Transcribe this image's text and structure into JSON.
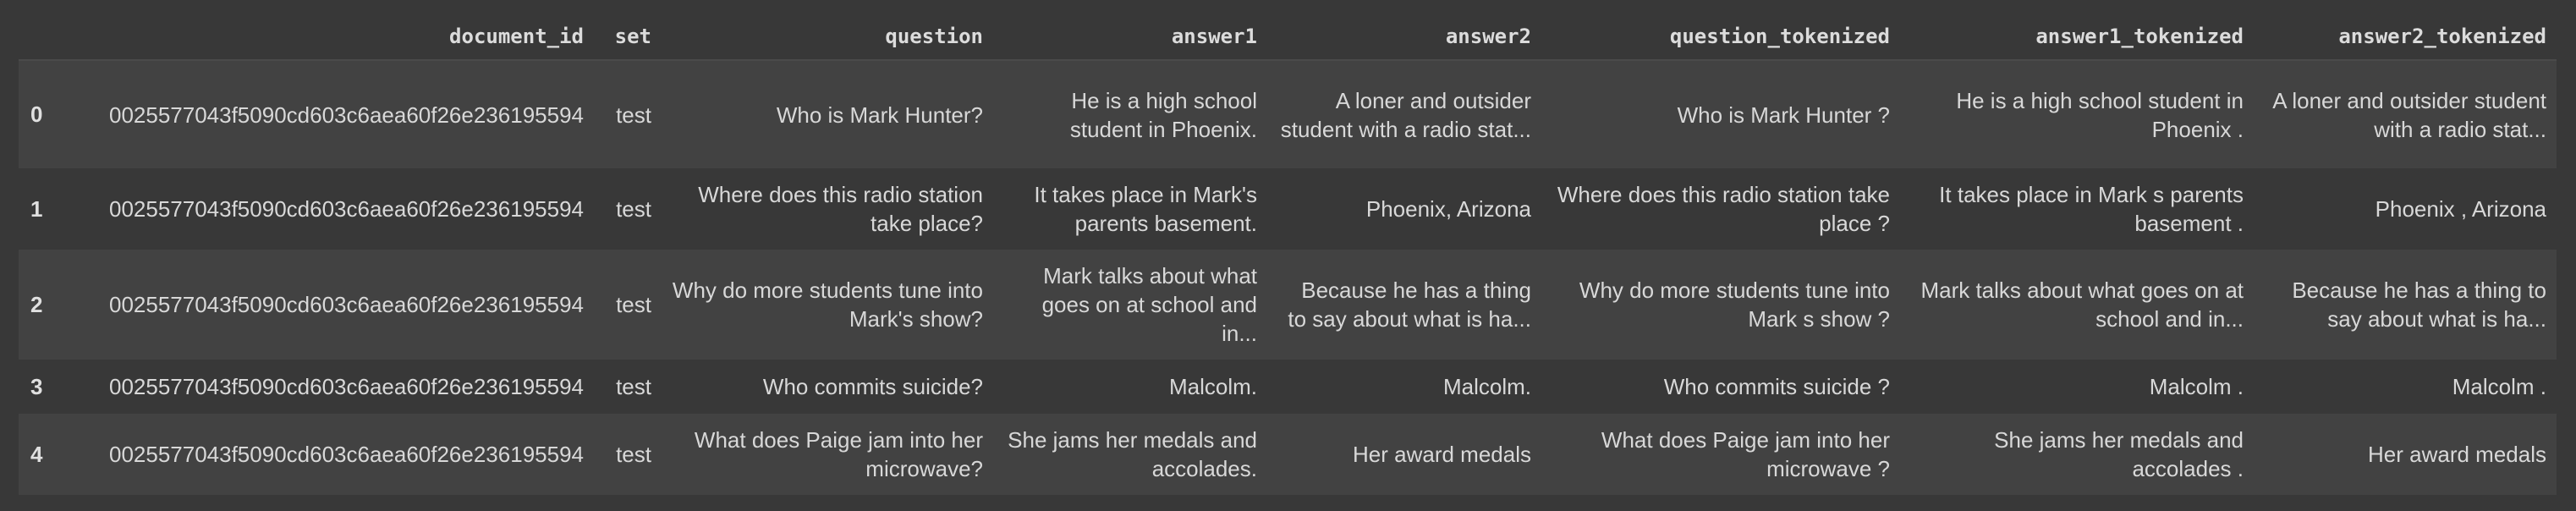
{
  "table": {
    "columns": [
      "",
      "document_id",
      "set",
      "question",
      "answer1",
      "answer2",
      "question_tokenized",
      "answer1_tokenized",
      "answer2_tokenized"
    ],
    "rows": [
      {
        "index": "0",
        "document_id": "0025577043f5090cd603c6aea60f26e236195594",
        "set": "test",
        "question": "Who is Mark Hunter?",
        "answer1": "He is a high school student in Phoenix.",
        "answer2": "A loner and outsider student with a radio stat...",
        "question_tokenized": "Who is Mark Hunter ?",
        "answer1_tokenized": "He is a high school student in Phoenix .",
        "answer2_tokenized": "A loner and outsider student with a radio stat..."
      },
      {
        "index": "1",
        "document_id": "0025577043f5090cd603c6aea60f26e236195594",
        "set": "test",
        "question": "Where does this radio station take place?",
        "answer1": "It takes place in Mark's parents basement.",
        "answer2": "Phoenix, Arizona",
        "question_tokenized": "Where does this radio station take place ?",
        "answer1_tokenized": "It takes place in Mark s parents basement .",
        "answer2_tokenized": "Phoenix , Arizona"
      },
      {
        "index": "2",
        "document_id": "0025577043f5090cd603c6aea60f26e236195594",
        "set": "test",
        "question": "Why do more students tune into Mark's show?",
        "answer1": "Mark talks about what goes on at school and in...",
        "answer2": "Because he has a thing to say about what is ha...",
        "question_tokenized": "Why do more students tune into Mark s show ?",
        "answer1_tokenized": "Mark talks about what goes on at school and in...",
        "answer2_tokenized": "Because he has a thing to say about what is ha..."
      },
      {
        "index": "3",
        "document_id": "0025577043f5090cd603c6aea60f26e236195594",
        "set": "test",
        "question": "Who commits suicide?",
        "answer1": "Malcolm.",
        "answer2": "Malcolm.",
        "question_tokenized": "Who commits suicide ?",
        "answer1_tokenized": "Malcolm .",
        "answer2_tokenized": "Malcolm ."
      },
      {
        "index": "4",
        "document_id": "0025577043f5090cd603c6aea60f26e236195594",
        "set": "test",
        "question": "What does Paige jam into her microwave?",
        "answer1": "She jams her medals and accolades.",
        "answer2": "Her award medals",
        "question_tokenized": "What does Paige jam into her microwave ?",
        "answer1_tokenized": "She jams her medals and accolades .",
        "answer2_tokenized": "Her award medals"
      }
    ]
  },
  "colors": {
    "background": "#383838",
    "row_even": "#424242",
    "row_odd": "#383838",
    "text": "#d8d8d8"
  }
}
